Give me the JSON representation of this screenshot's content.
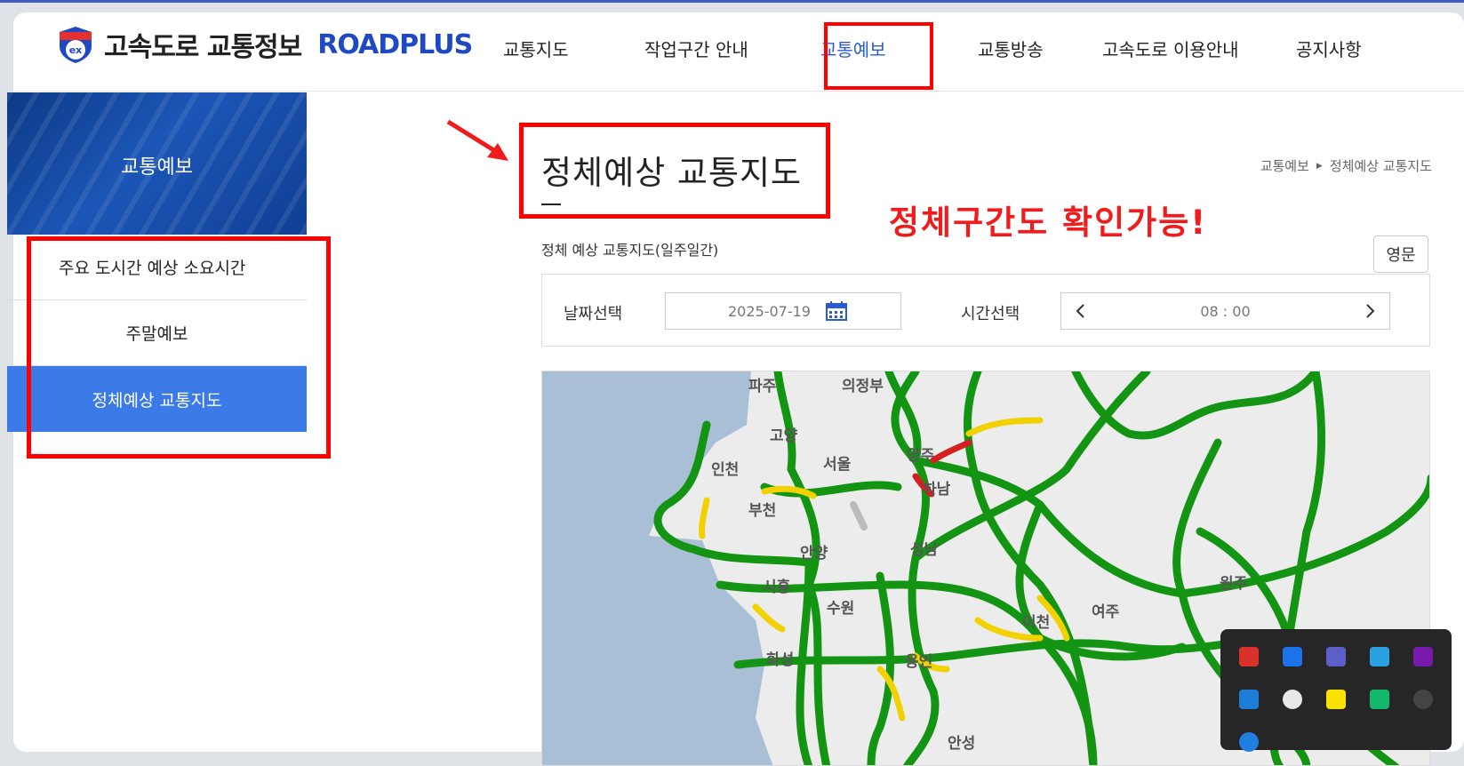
{
  "brand": {
    "korean": "고속도로 교통정보",
    "name": "ROADPLUS"
  },
  "nav": [
    "교통지도",
    "작업구간 안내",
    "교통예보",
    "교통방송",
    "고속도로 이용안내",
    "공지사항"
  ],
  "nav_active": "교통예보",
  "sidebar": {
    "banner_title": "교통예보",
    "items": [
      "주요 도시간 예상 소요시간",
      "주말예보",
      "정체예상 교통지도"
    ],
    "active": "정체예상 교통지도"
  },
  "page": {
    "title": "정체예상 교통지도",
    "breadcrumb": [
      "교통예보",
      "정체예상 교통지도"
    ],
    "subtitle": "정체 예상 교통지도(일주일간)",
    "english_button": "영문"
  },
  "annotation": "정체구간도 확인가능!",
  "filter": {
    "date_label": "날짜선택",
    "date_value": "2025-07-19",
    "time_label": "시간선택",
    "time_value": "08 : 00"
  },
  "map": {
    "labels": [
      "파주",
      "의정부",
      "고양",
      "양주",
      "인천",
      "서울",
      "하남",
      "부천",
      "안양",
      "성남",
      "시흥",
      "수원",
      "이천",
      "여주",
      "원주",
      "화성",
      "용인",
      "안성"
    ],
    "colors": {
      "free": "#139513",
      "slow": "#f2d100",
      "jam": "#d42020",
      "sea": "#a8bfd6",
      "land": "#ececec"
    }
  },
  "tray_icons": [
    "powerpoint-icon",
    "snipping-icon",
    "teams-icon",
    "defender-icon",
    "onenote-icon",
    "security-warning-icon",
    "onedrive-icon",
    "kakaotalk-icon",
    "kleopatra-icon",
    "creative-cloud-icon",
    "bluetooth-icon"
  ]
}
